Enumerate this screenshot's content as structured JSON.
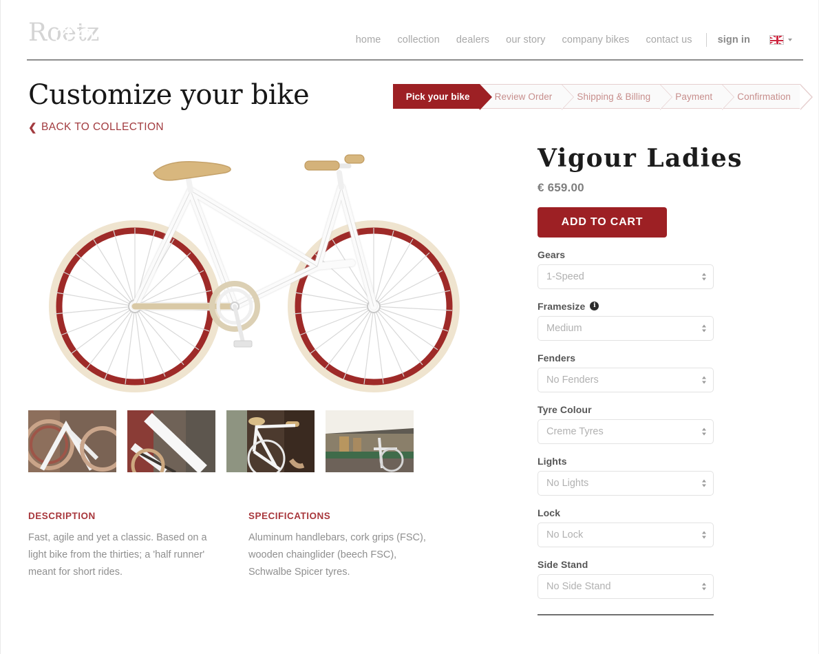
{
  "header": {
    "logo_text": "Roetz",
    "logo_icon": "bicycle-icon",
    "nav": [
      {
        "label": "home",
        "name": "nav-home"
      },
      {
        "label": "collection",
        "name": "nav-collection"
      },
      {
        "label": "dealers",
        "name": "nav-dealers"
      },
      {
        "label": "our story",
        "name": "nav-our-story"
      },
      {
        "label": "company bikes",
        "name": "nav-company-bikes"
      },
      {
        "label": "contact us",
        "name": "nav-contact-us"
      }
    ],
    "sign_in": "sign in",
    "language_icon": "uk-flag-icon",
    "language_caret": "chevron-down-icon"
  },
  "title_block": {
    "page_title": "Customize your bike",
    "back_link": "BACK TO COLLECTION",
    "back_chevron": "❮"
  },
  "steps": [
    {
      "label": "Pick your bike",
      "active": true
    },
    {
      "label": "Review Order",
      "active": false
    },
    {
      "label": "Shipping & Billing",
      "active": false
    },
    {
      "label": "Payment",
      "active": false
    },
    {
      "label": "Confirmation",
      "active": false
    }
  ],
  "gallery": {
    "hero_alt": "white-ladies-bicycle-with-red-cream-tyres",
    "thumbnails": [
      {
        "alt": "rear-wheel-and-frame-detail"
      },
      {
        "alt": "frame-tube-closeup"
      },
      {
        "alt": "handlebar-and-saddle-view"
      },
      {
        "alt": "bike-parked-under-awning"
      }
    ]
  },
  "info": {
    "description_heading": "DESCRIPTION",
    "description_body": "Fast, agile and yet a classic. Based on a light bike from the thirties; a 'half runner' meant for short rides.",
    "specifications_heading": "SPECIFICATIONS",
    "specifications_body": "Aluminum handlebars, cork grips (FSC), wooden chainglider (beech FSC), Schwalbe Spicer tyres."
  },
  "product": {
    "title": "Vigour Ladies",
    "price": "€ 659.00",
    "add_to_cart": "ADD TO CART",
    "options": [
      {
        "label": "Gears",
        "value": "1-Speed",
        "has_info": false,
        "name": "gears"
      },
      {
        "label": "Framesize",
        "value": "Medium",
        "has_info": true,
        "info_glyph": "i",
        "name": "framesize"
      },
      {
        "label": "Fenders",
        "value": "No Fenders",
        "has_info": false,
        "name": "fenders"
      },
      {
        "label": "Tyre Colour",
        "value": "Creme Tyres",
        "has_info": false,
        "name": "tyre-colour"
      },
      {
        "label": "Lights",
        "value": "No Lights",
        "has_info": false,
        "name": "lights"
      },
      {
        "label": "Lock",
        "value": "No Lock",
        "has_info": false,
        "name": "lock"
      },
      {
        "label": "Side Stand",
        "value": "No Side Stand",
        "has_info": false,
        "name": "side-stand"
      }
    ]
  },
  "colors": {
    "brand_red": "#9d2024",
    "link_red": "#a23b3f",
    "heading_red": "#a8373c",
    "muted_text": "#8f8f8f",
    "logo_grey": "#d4d4d4"
  }
}
